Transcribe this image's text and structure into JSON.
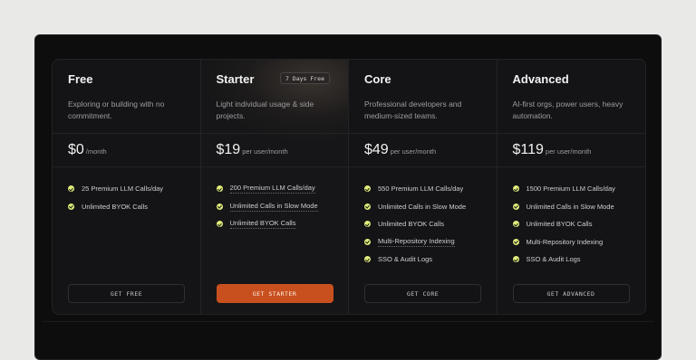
{
  "plans": [
    {
      "name": "Free",
      "badge": "",
      "description": "Exploring or building with no commitment.",
      "price": "$0",
      "unit": "/month",
      "features": [
        {
          "label": "25 Premium LLM Calls/day",
          "underline": false
        },
        {
          "label": "Unlimited BYOK Calls",
          "underline": false
        }
      ],
      "cta": "GET FREE",
      "primary": false
    },
    {
      "name": "Starter",
      "badge": "7 Days Free",
      "description": "Light individual usage & side projects.",
      "price": "$19",
      "unit": "per user/month",
      "features": [
        {
          "label": "200 Premium LLM Calls/day",
          "underline": true
        },
        {
          "label": "Unlimited Calls in Slow Mode",
          "underline": true
        },
        {
          "label": "Unlimited BYOK Calls",
          "underline": true
        }
      ],
      "cta": "GET STARTER",
      "primary": true
    },
    {
      "name": "Core",
      "badge": "",
      "description": "Professional developers and medium-sized teams.",
      "price": "$49",
      "unit": "per user/month",
      "features": [
        {
          "label": "550 Premium LLM Calls/day",
          "underline": false
        },
        {
          "label": "Unlimited Calls in Slow Mode",
          "underline": false
        },
        {
          "label": "Unlimited BYOK Calls",
          "underline": false
        },
        {
          "label": "Multi-Repository Indexing",
          "underline": true
        },
        {
          "label": "SSO & Audit Logs",
          "underline": false
        }
      ],
      "cta": "GET CORE",
      "primary": false
    },
    {
      "name": "Advanced",
      "badge": "",
      "description": "AI-first orgs, power users, heavy automation.",
      "price": "$119",
      "unit": "per user/month",
      "features": [
        {
          "label": "1500 Premium LLM Calls/day",
          "underline": false
        },
        {
          "label": "Unlimited Calls in Slow Mode",
          "underline": false
        },
        {
          "label": "Unlimited BYOK Calls",
          "underline": false
        },
        {
          "label": "Multi-Repository Indexing",
          "underline": false
        },
        {
          "label": "SSO & Audit Logs",
          "underline": false
        }
      ],
      "cta": "GET ADVANCED",
      "primary": false
    }
  ],
  "colors": {
    "accent": "#c8501e",
    "check": "#e0ec7a",
    "background": "#141416"
  }
}
